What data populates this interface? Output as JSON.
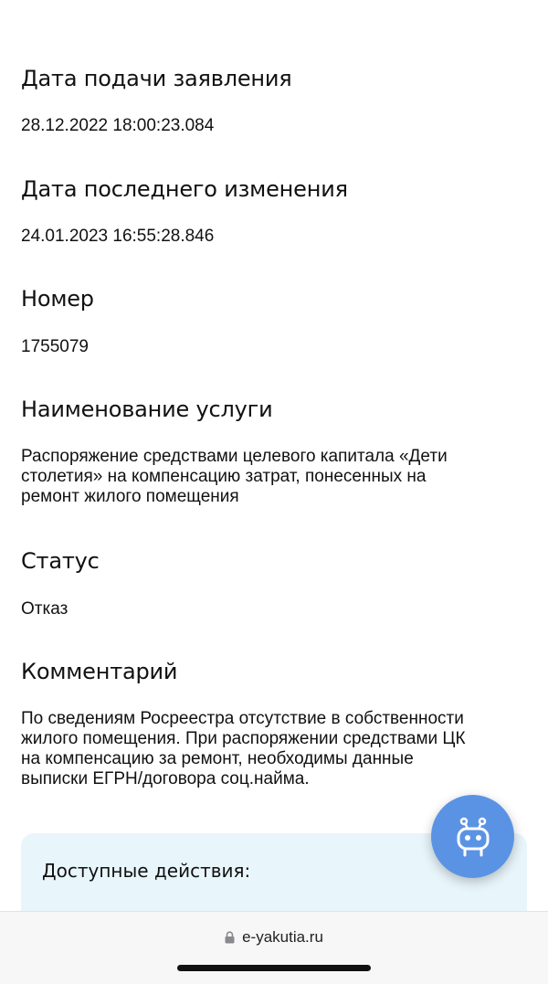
{
  "fields": [
    {
      "label": "Дата подачи заявления",
      "value": "28.12.2022 18:00:23.084"
    },
    {
      "label": "Дата последнего изменения",
      "value": "24.01.2023 16:55:28.846"
    },
    {
      "label": "Номер",
      "value": "1755079"
    },
    {
      "label": "Наименование услуги",
      "value_lines": [
        "Распоряжение средствами целевого капитала «Дети",
        "столетия» на компенсацию затрат, понесенных на",
        "ремонт жилого помещения"
      ]
    },
    {
      "label": "Статус",
      "value": "Отказ"
    },
    {
      "label": "Комментарий",
      "value_lines": [
        "По сведениям Росреестра отсутствие в собственности",
        "жилого помещения. При распоряжении средствами ЦК",
        "на компенсацию за ремонт, необходимы данные",
        "выписки ЕГРН/договора соц.найма."
      ]
    }
  ],
  "actions": {
    "title": "Доступные действия:"
  },
  "assistant_button": {
    "icon": "robot-icon",
    "color": "#5b93e4"
  },
  "browser": {
    "url": "e-yakutia.ru",
    "lock_icon": "lock-icon"
  }
}
